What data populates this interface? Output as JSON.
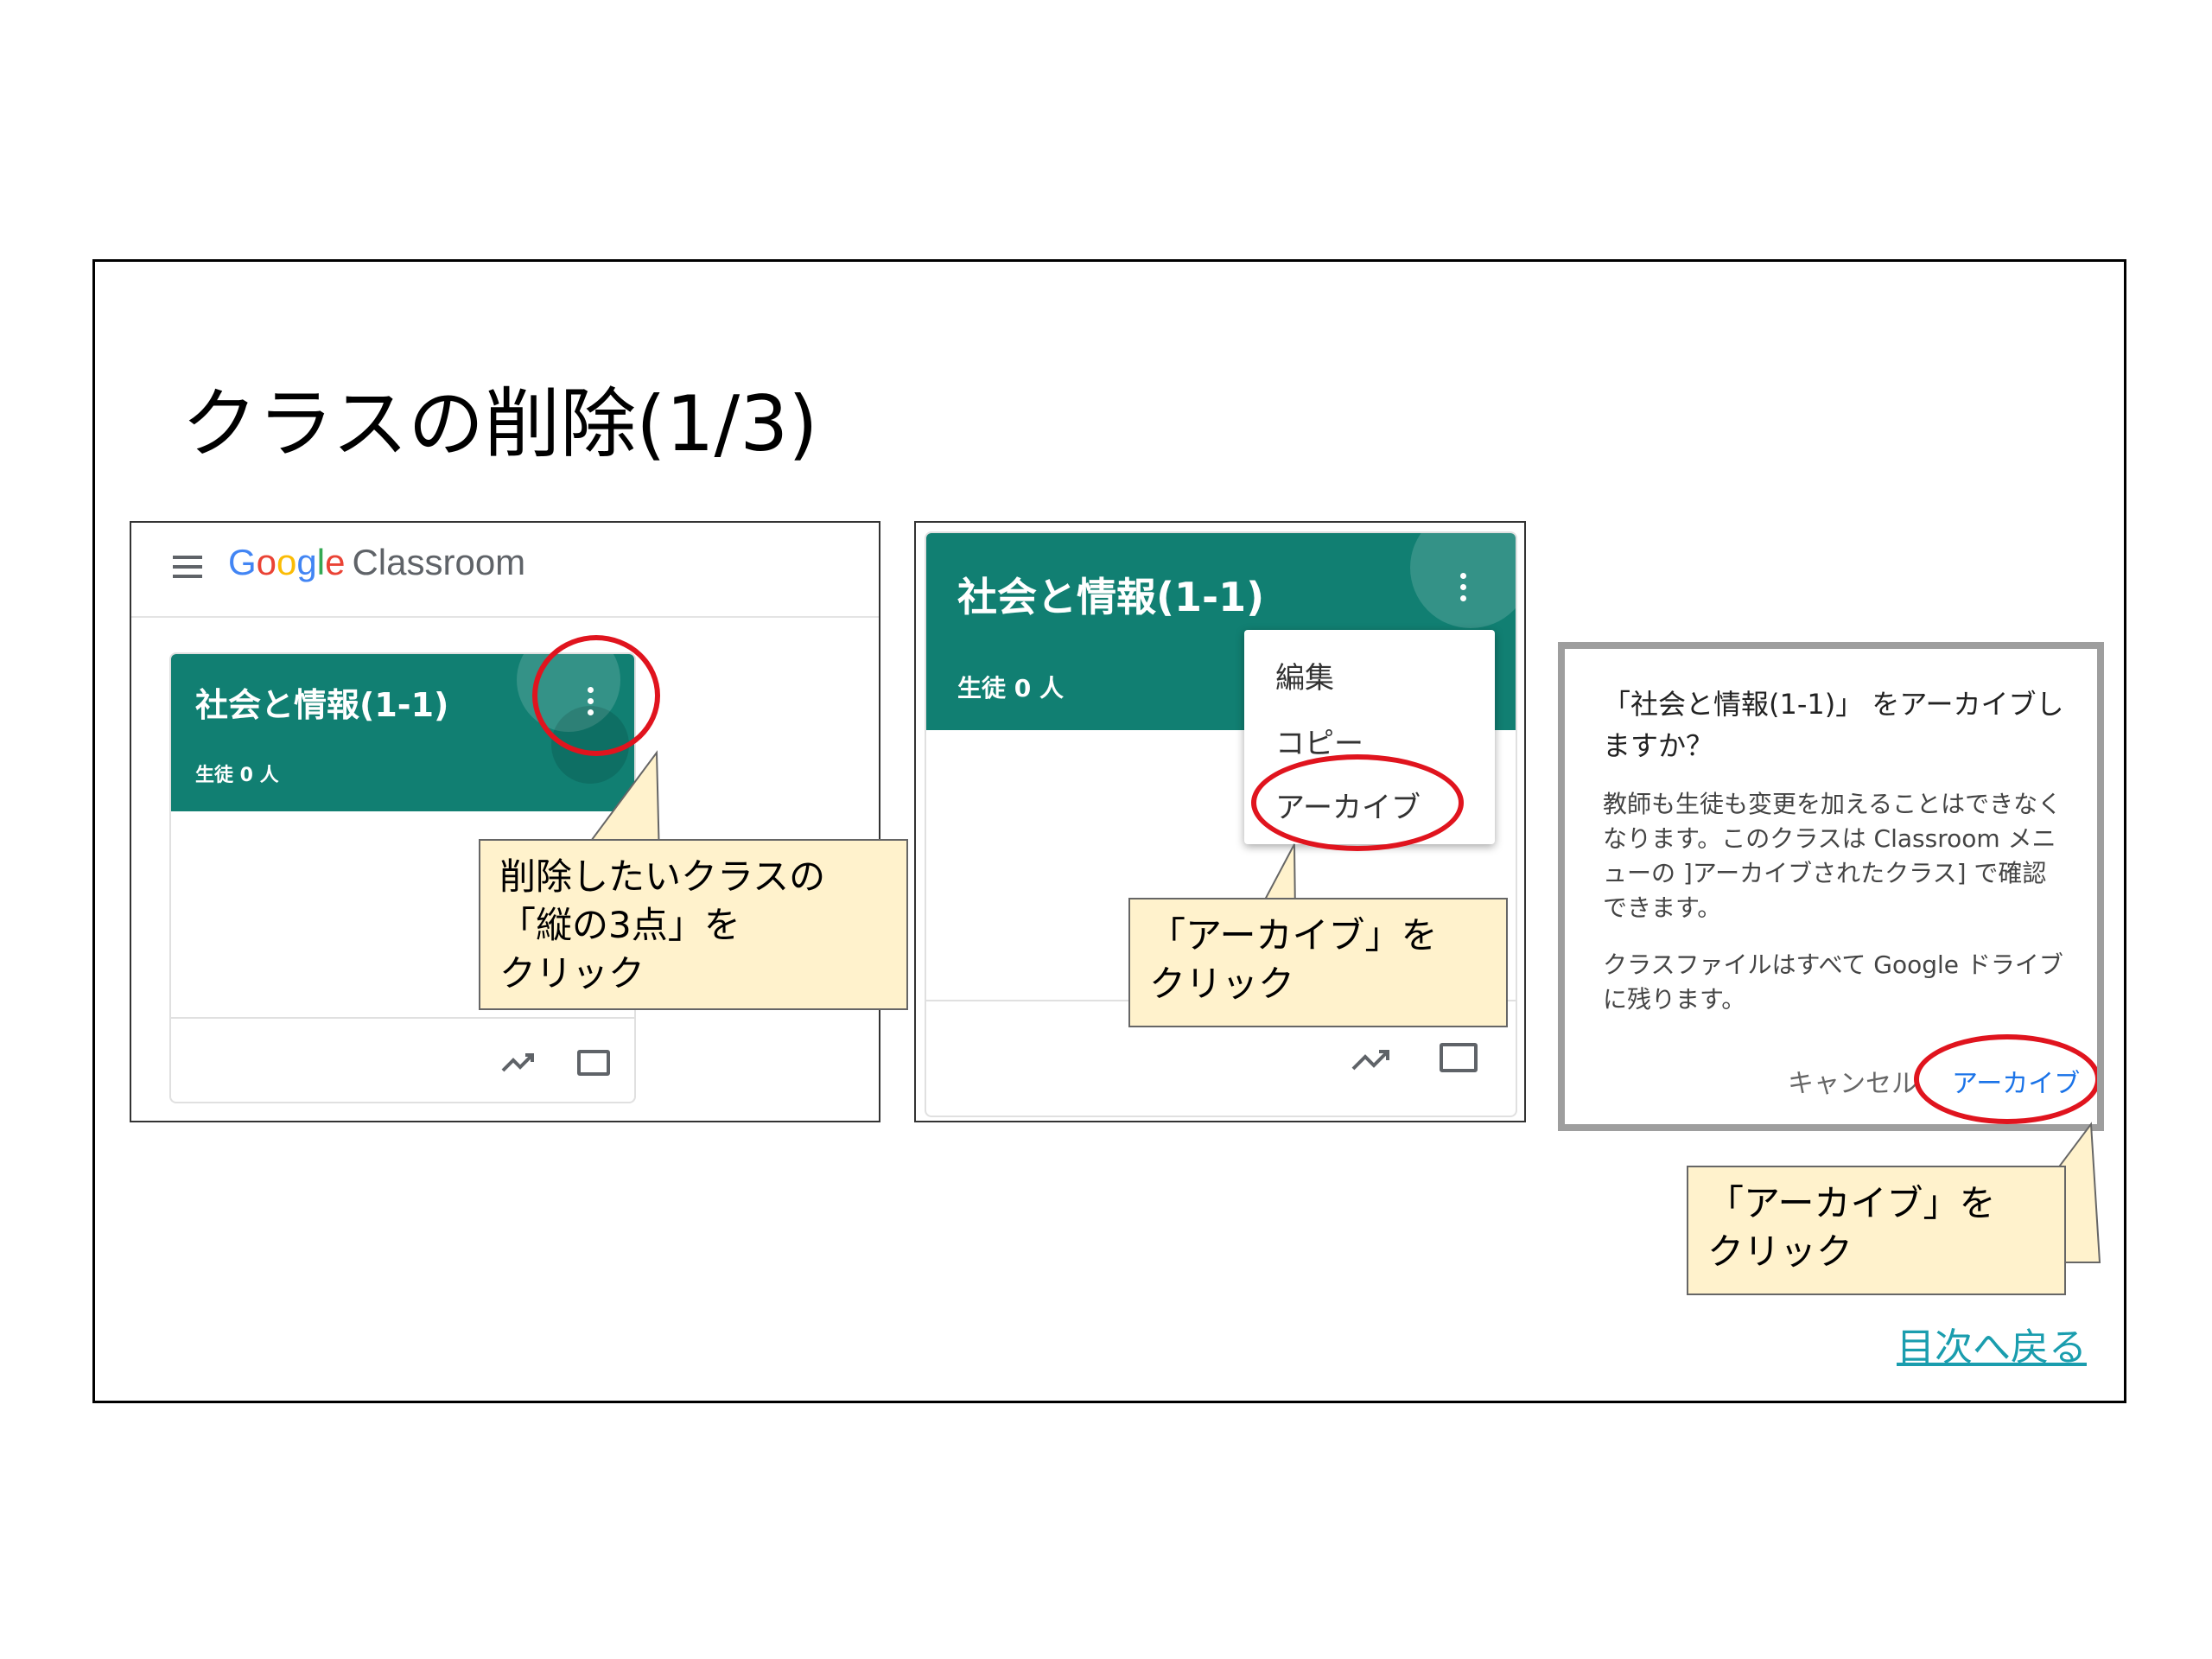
{
  "slide": {
    "title": "クラスの削除(1/3)",
    "back_link": "目次へ戻る"
  },
  "panel1": {
    "app_name": "Classroom",
    "google_letters": [
      "G",
      "o",
      "o",
      "g",
      "l",
      "e"
    ],
    "class_title": "社会と情報(1-1)",
    "students": "生徒 0 人",
    "callout": [
      "削除したいクラスの",
      "「縦の3点」を",
      "クリック"
    ]
  },
  "panel2": {
    "class_title": "社会と情報(1-1)",
    "students": "生徒 0 人",
    "menu": [
      "編集",
      "コピー",
      "アーカイブ"
    ],
    "callout": [
      "「アーカイブ」を",
      "クリック"
    ]
  },
  "panel3": {
    "dialog_title": "「社会と情報(1-1)」 をアーカイブしますか？",
    "body1": "教師も生徒も変更を加えることはできなくなります。このクラスは Classroom メニューの ]アーカイブされたクラス] で確認できます。",
    "body2": "クラスファイルはすべて Google ドライブに残ります。",
    "cancel": "キャンセル",
    "archive": "アーカイブ",
    "callout": [
      "「アーカイブ」を",
      "クリック"
    ]
  },
  "colors": {
    "card_green": "#117f72",
    "highlight_red": "#e0141e",
    "callout_fill": "#fff2cc",
    "link": "#1a9dae"
  }
}
